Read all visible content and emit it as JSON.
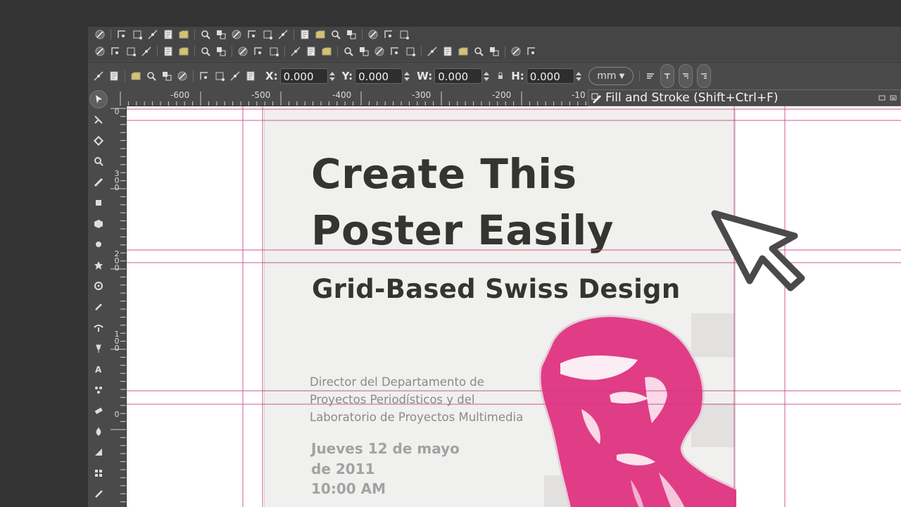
{
  "toolbar": {
    "x_label": "X:",
    "x_value": "0.000",
    "y_label": "Y:",
    "y_value": "0.000",
    "w_label": "W:",
    "w_value": "0.000",
    "h_label": "H:",
    "h_value": "0.000",
    "unit": "mm"
  },
  "ruler_top": [
    "-600",
    "-500",
    "-400",
    "-300",
    "-200",
    "-10"
  ],
  "ruler_left": [
    {
      "chars": [
        "0"
      ]
    },
    {
      "chars": [
        "3",
        "0",
        "0"
      ]
    },
    {
      "chars": [
        "2",
        "0",
        "0"
      ]
    },
    {
      "chars": [
        "1",
        "0",
        "0"
      ]
    },
    {
      "chars": [
        "0"
      ]
    }
  ],
  "panel": {
    "title": "Fill and Stroke (Shift+Ctrl+F)"
  },
  "poster": {
    "title_line1": "Create This",
    "title_line2": "Poster Easily",
    "subtitle": "Grid-Based Swiss Design",
    "description": [
      "Director del Departamento de",
      "Proyectos Periodísticos y del",
      "Laboratorio de Proyectos Multimedia"
    ],
    "date": [
      "Jueves 12 de mayo",
      "de 2011",
      "10:00 AM"
    ],
    "portrait_color": "#e03d86"
  },
  "colors": {
    "guide": "#c83c84",
    "ui_bg": "#4a4a4a",
    "title_text": "#353431"
  },
  "icons": {
    "row1": [
      "snap-toggle-icon",
      "snap-bbox-icon",
      "snap-bbox-edge-icon",
      "snap-bbox-corner-icon",
      "snap-midpoint-icon",
      "snap-center-icon",
      "snap-nodes-icon",
      "snap-path-icon",
      "snap-intersection-icon",
      "snap-cusp-icon",
      "snap-smooth-icon",
      "snap-line-mid-icon",
      "snap-others-icon",
      "snap-object-center-icon",
      "snap-rotation-icon",
      "snap-text-baseline-icon",
      "snap-page-icon",
      "snap-grid-icon",
      "snap-guide-icon"
    ],
    "row2": [
      "new-file-icon",
      "open-icon",
      "save-icon",
      "print-icon",
      "import-icon",
      "export-icon",
      "undo-icon",
      "redo-icon",
      "copy-icon",
      "cut-icon",
      "paste-icon",
      "zoom-selection-icon",
      "zoom-drawing-icon",
      "zoom-page-icon",
      "duplicate-icon",
      "clone-icon",
      "unlink-clone-icon",
      "group-icon",
      "ungroup-icon",
      "fill-stroke-icon",
      "text-font-icon",
      "layers-icon",
      "xml-editor-icon",
      "align-icon",
      "document-properties-icon",
      "preferences-icon"
    ],
    "row3": [
      "select-all-icon",
      "select-all-layers-icon",
      "rotate-ccw-icon",
      "rotate-cw-icon",
      "flip-horizontal-icon",
      "flip-vertical-icon",
      "raise-to-top-icon",
      "raise-icon",
      "lower-icon",
      "lower-to-bottom-icon"
    ],
    "tools": [
      "selector-tool-icon",
      "node-tool-icon",
      "tweak-tool-icon",
      "zoom-tool-icon",
      "measure-tool-icon",
      "rect-tool-icon",
      "box3d-tool-icon",
      "ellipse-tool-icon",
      "star-tool-icon",
      "spiral-tool-icon",
      "pencil-tool-icon",
      "pen-tool-icon",
      "calligraphy-tool-icon",
      "text-tool-icon",
      "spray-tool-icon",
      "eraser-tool-icon",
      "bucket-tool-icon",
      "gradient-tool-icon",
      "mesh-tool-icon",
      "dropper-tool-icon"
    ]
  }
}
